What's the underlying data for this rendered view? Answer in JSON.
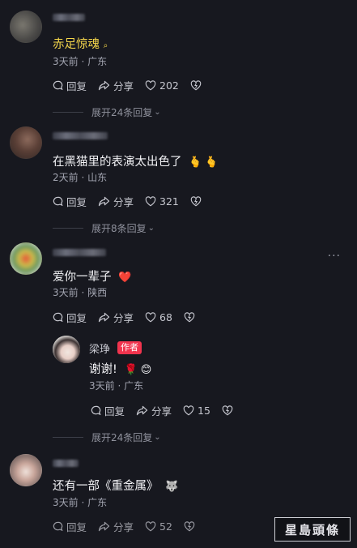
{
  "comments": [
    {
      "username": "",
      "content": "赤足惊魂",
      "search_hint": "search-icon",
      "time": "3天前",
      "location": "广东",
      "reply_label": "回复",
      "share_label": "分享",
      "likes": "202",
      "expand_label": "展开24条回复"
    },
    {
      "content": "在黑猫里的表演太出色了",
      "emoji": "🫰 🫰",
      "time": "2天前",
      "location": "山东",
      "reply_label": "回复",
      "share_label": "分享",
      "likes": "321",
      "expand_label": "展开8条回复"
    },
    {
      "content": "爱你一辈子",
      "emoji": "❤️",
      "time": "3天前",
      "location": "陕西",
      "reply_label": "回复",
      "share_label": "分享",
      "likes": "68"
    },
    {
      "username": "梁琤",
      "badge": "作者",
      "content": "谢谢!",
      "emoji": "🌹 😊",
      "time": "3天前",
      "location": "广东",
      "reply_label": "回复",
      "share_label": "分享",
      "likes": "15",
      "expand_label": "展开24条回复"
    },
    {
      "content": "还有一部《重金属》",
      "emoji": "🐺",
      "time": "3天前",
      "location": "广东",
      "reply_label": "回复",
      "share_label": "分享",
      "likes": "52"
    }
  ],
  "more_menu": "···",
  "watermark": "星島頭條",
  "colors": {
    "background": "#17181f",
    "highlight": "#f6d74b",
    "badge": "#f2344e",
    "heart": "#f2344e"
  }
}
